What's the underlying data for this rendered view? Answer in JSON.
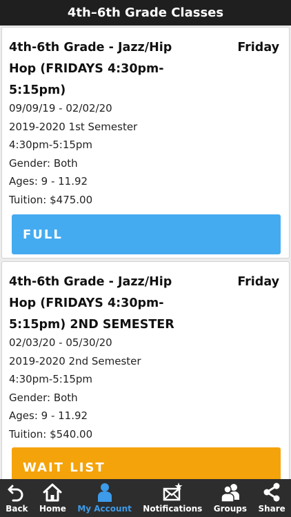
{
  "header": {
    "title": "4th–6th Grade Classes"
  },
  "classes": [
    {
      "title_line1": "4th-6th Grade - Jazz/Hip",
      "title_line2": "Hop (FRIDAYS 4:30pm-",
      "title_line3": "5:15pm)",
      "day": "Friday",
      "dates": "09/09/19 - 02/02/20",
      "session": "2019-2020 1st Semester",
      "time": "4:30pm-5:15pm",
      "gender": "Gender: Both",
      "ages": "Ages: 9 - 11.92",
      "tuition": "Tuition: $475.00",
      "status": "FULL",
      "status_color": "#45abf0"
    },
    {
      "title_line1": "4th-6th Grade - Jazz/Hip",
      "title_line2": "Hop (FRIDAYS 4:30pm-",
      "title_line3": "5:15pm) 2ND SEMESTER",
      "day": "Friday",
      "dates": "02/03/20 - 05/30/20",
      "session": "2019-2020 2nd Semester",
      "time": "4:30pm-5:15pm",
      "gender": "Gender: Both",
      "ages": "Ages: 9 - 11.92",
      "tuition": "Tuition: $540.00",
      "status": "WAIT LIST",
      "status_color": "#f5a30b"
    }
  ],
  "tabbar": {
    "items": [
      {
        "label": "Back",
        "icon": "back-arrow-icon"
      },
      {
        "label": "Home",
        "icon": "home-icon"
      },
      {
        "label": "My Account",
        "icon": "person-icon",
        "active": true
      },
      {
        "label": "Notifications",
        "icon": "envelope-star-icon"
      },
      {
        "label": "Groups",
        "icon": "group-icon"
      },
      {
        "label": "Share",
        "icon": "share-icon"
      }
    ],
    "active_color": "#3d9be9"
  }
}
